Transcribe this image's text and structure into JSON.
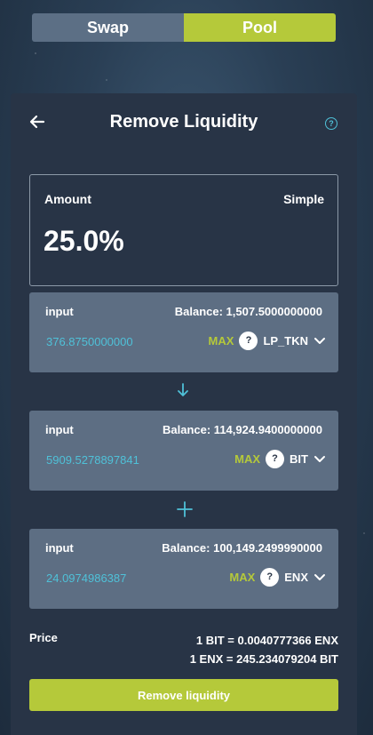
{
  "tabs": {
    "swap": "Swap",
    "pool": "Pool"
  },
  "header": {
    "title": "Remove Liquidity",
    "help": "?"
  },
  "amount": {
    "label": "Amount",
    "mode": "Simple",
    "value": "25.0%"
  },
  "cards": [
    {
      "label": "input",
      "balance": "Balance: 1,507.5000000000",
      "amount": "376.8750000000",
      "max": "MAX",
      "help": "?",
      "token": "LP_TKN"
    },
    {
      "label": "input",
      "balance": "Balance: 114,924.9400000000",
      "amount": "5909.5278897841",
      "max": "MAX",
      "help": "?",
      "token": "BIT"
    },
    {
      "label": "input",
      "balance": "Balance: 100,149.2499990000",
      "amount": "24.0974986387",
      "max": "MAX",
      "help": "?",
      "token": "ENX"
    }
  ],
  "price": {
    "label": "Price",
    "line1": "1 BIT = 0.0040777366 ENX",
    "line2": "1 ENX = 245.234079204 BIT"
  },
  "action": {
    "label": "Remove liquidity"
  },
  "colors": {
    "accent": "#b5c93a",
    "cyan": "#4fc1d8",
    "panel": "#283446",
    "card": "#5d6e83"
  }
}
